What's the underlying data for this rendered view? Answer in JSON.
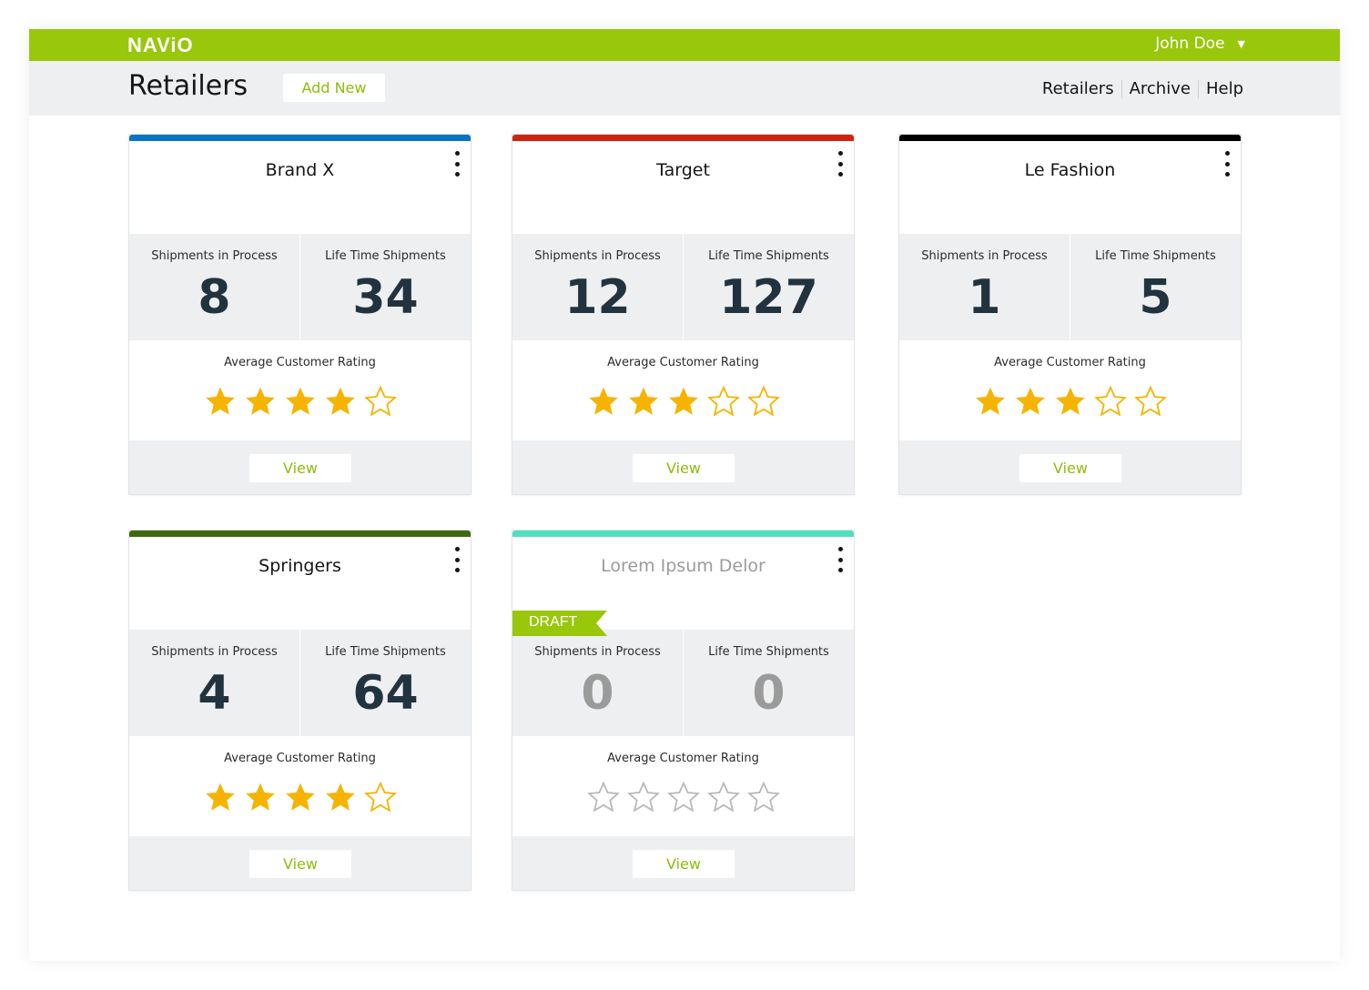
{
  "header": {
    "logo": "NAViO",
    "user_name": "John Doe",
    "user_caret": "▼"
  },
  "subheader": {
    "title": "Retailers",
    "add_new_label": "Add New",
    "nav": [
      "Retailers",
      "Archive",
      "Help"
    ]
  },
  "card_labels": {
    "shipments_in_process": "Shipments in Process",
    "life_time_shipments": "Life Time Shipments",
    "average_rating": "Average Customer Rating",
    "view": "View"
  },
  "retailers": [
    {
      "name": "Brand X",
      "accent": "#0a74c4",
      "in_process": "8",
      "lifetime": "34",
      "rating": 4,
      "max_rating": 5,
      "draft": false
    },
    {
      "name": "Target",
      "accent": "#d0230f",
      "in_process": "12",
      "lifetime": "127",
      "rating": 3,
      "max_rating": 5,
      "draft": false
    },
    {
      "name": "Le Fashion",
      "accent": "#000000",
      "in_process": "1",
      "lifetime": "5",
      "rating": 3,
      "max_rating": 5,
      "draft": false
    },
    {
      "name": "Springers",
      "accent": "#3d6b0c",
      "in_process": "4",
      "lifetime": "64",
      "rating": 4,
      "max_rating": 5,
      "draft": false
    },
    {
      "name": "Lorem Ipsum Delor",
      "accent": "#4fe0c0",
      "in_process": "0",
      "lifetime": "0",
      "rating": 0,
      "max_rating": 5,
      "draft": true,
      "draft_label": "DRAFT"
    }
  ],
  "colors": {
    "brand_green": "#99c70c",
    "star_filled": "#f6b400",
    "star_outline_active": "#f6b400",
    "star_outline_inactive": "#b9b9b9"
  }
}
